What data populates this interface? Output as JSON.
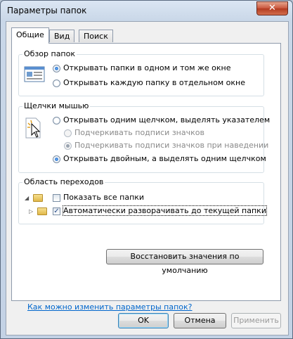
{
  "window": {
    "title": "Параметры папок",
    "close_glyph": "✕"
  },
  "tabs": [
    {
      "label": "Общие",
      "active": true
    },
    {
      "label": "Вид",
      "active": false
    },
    {
      "label": "Поиск",
      "active": false
    }
  ],
  "browse_group": {
    "title": "Обзор папок",
    "icon": "folder-window-icon",
    "options": [
      {
        "label": "Открывать папки в одном и том же окне",
        "checked": true
      },
      {
        "label": "Открывать каждую папку в отдельном окне",
        "checked": false
      }
    ]
  },
  "clicks_group": {
    "title": "Щелчки мышью",
    "icon": "mouse-click-icon",
    "options": [
      {
        "label": "Открывать одним щелчком, выделять указателем",
        "checked": false
      },
      {
        "label": "Подчеркивать подписи значков",
        "checked": false,
        "disabled": true
      },
      {
        "label": "Подчеркивать подписи значков при наведении",
        "checked": true,
        "disabled": true
      },
      {
        "label": "Открывать двойным, а выделять одним щелчком",
        "checked": true
      }
    ]
  },
  "nav_group": {
    "title": "Область переходов",
    "options": [
      {
        "label": "Показать все папки",
        "checked": false
      },
      {
        "label": "Автоматически разворачивать до текущей папки",
        "checked": true
      }
    ]
  },
  "restore_button": "Восстановить значения по умолчанию",
  "help_link": "Как можно изменить параметры папок?",
  "buttons": {
    "ok": "OK",
    "cancel": "Отмена",
    "apply": "Применить"
  }
}
